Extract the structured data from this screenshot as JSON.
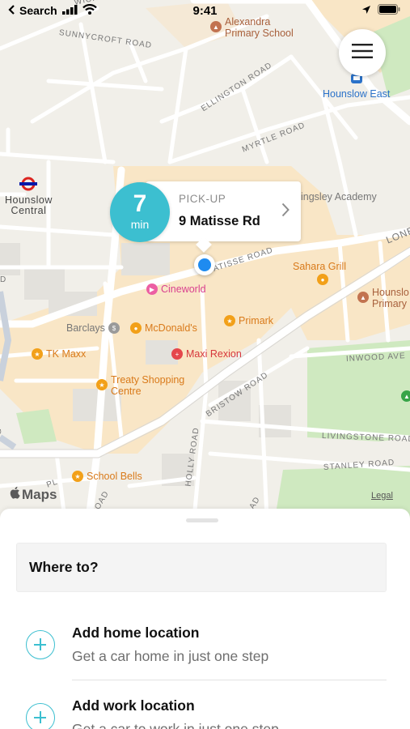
{
  "status_bar": {
    "back_label": "Search",
    "time": "9:41"
  },
  "map": {
    "place_labels": {
      "hounslow_central": "Hounslow\nCentral",
      "hounslow_east": "Hounslow East",
      "alexandra_school": "Alexandra\nPrimary School",
      "kingsley_academy": "ingsley Academy",
      "hounslow_primary": "Hounslo\nPrimary"
    },
    "roads": {
      "sunnycroft": "SUNNYCROFT ROAD",
      "wick": "WICK ROA",
      "ellington": "ELLINGTON ROAD",
      "myrtle": "MYRTLE ROAD",
      "matisse": "MATISSE ROAD",
      "london": "LONE",
      "inwood": "INWOOD AVE",
      "bristow": "BRISTOW ROAD",
      "livingstone": "LIVINGSTONE ROAD",
      "stanley": "STANLEY ROAD",
      "holly": "HOLLY ROAD",
      "road_left": "ROAD",
      "pl": "PL",
      "d_left": "D",
      "oad": "OAD"
    },
    "pois": {
      "cineworld": "Cineworld",
      "barclays": "Barclays",
      "mcdonalds": "McDonald's",
      "primark": "Primark",
      "tk_maxx": "TK Maxx",
      "maxi_rexion": "Maxi Rexion",
      "treaty_centre": "Treaty Shopping\nCentre",
      "sahara_grill": "Sahara Grill",
      "school_bells": "School Bells"
    },
    "attribution": "Maps",
    "legal": "Legal"
  },
  "pickup": {
    "eta_value": "7",
    "eta_unit": "min",
    "label": "PICK-UP",
    "address": "9 Matisse Rd"
  },
  "sheet": {
    "search_placeholder": "Where to?",
    "home": {
      "title": "Add home location",
      "subtitle": "Get a car home in just one step"
    },
    "work": {
      "title": "Add work location",
      "subtitle": "Get a car to work in just one step"
    }
  },
  "colors": {
    "accent": "#3cbfd0",
    "location_dot": "#1e8bf0",
    "map_land": "#f1efe9",
    "map_commercial": "#f9e6c6",
    "map_park": "#cfe9c0"
  },
  "icons": [
    "signal-icon",
    "wifi-icon",
    "location-arrow-icon",
    "battery-icon",
    "menu-icon",
    "chevron-right-icon",
    "plus-circle-icon",
    "apple-icon",
    "underground-icon"
  ]
}
